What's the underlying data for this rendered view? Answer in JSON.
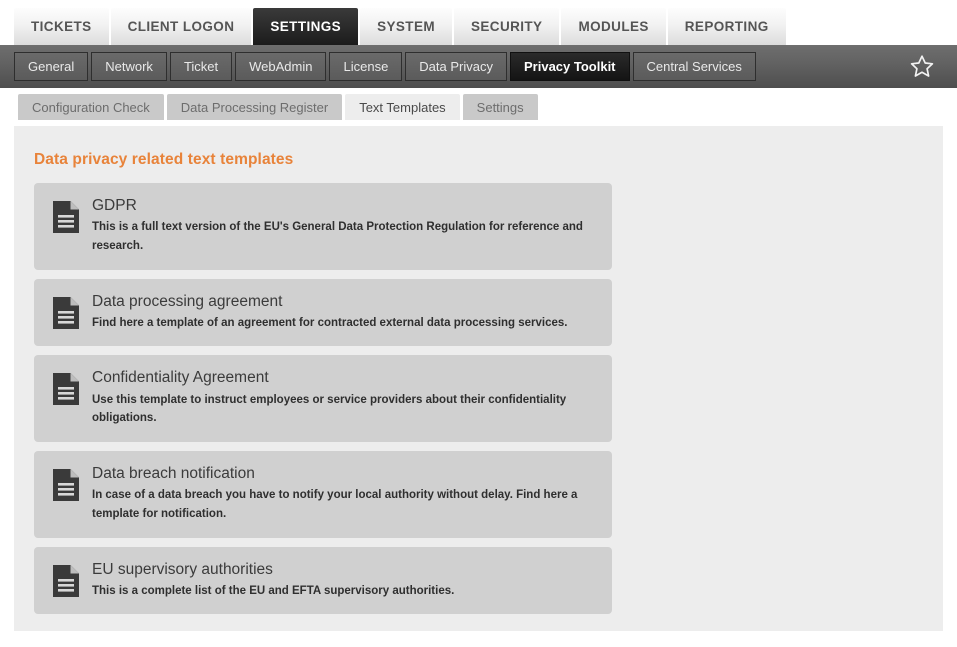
{
  "module_tabs": [
    {
      "label": "TICKETS",
      "active": false
    },
    {
      "label": "CLIENT LOGON",
      "active": false
    },
    {
      "label": "SETTINGS",
      "active": true
    },
    {
      "label": "SYSTEM",
      "active": false
    },
    {
      "label": "SECURITY",
      "active": false
    },
    {
      "label": "MODULES",
      "active": false
    },
    {
      "label": "REPORTING",
      "active": false
    }
  ],
  "subnav": {
    "items": [
      {
        "label": "General",
        "active": false
      },
      {
        "label": "Network",
        "active": false
      },
      {
        "label": "Ticket",
        "active": false
      },
      {
        "label": "WebAdmin",
        "active": false
      },
      {
        "label": "License",
        "active": false
      },
      {
        "label": "Data Privacy",
        "active": false
      },
      {
        "label": "Privacy Toolkit",
        "active": true
      },
      {
        "label": "Central Services",
        "active": false
      }
    ],
    "favorite_icon": "star-icon"
  },
  "content_tabs": [
    {
      "label": "Configuration Check",
      "active": false
    },
    {
      "label": "Data Processing Register",
      "active": false
    },
    {
      "label": "Text Templates",
      "active": true
    },
    {
      "label": "Settings",
      "active": false
    }
  ],
  "panel": {
    "title": "Data privacy related text templates",
    "title_color": "#e8833a",
    "background": "#ededed"
  },
  "templates": [
    {
      "icon": "document-icon",
      "title": "GDPR",
      "description": "This is a full text version of the EU's General Data Protection Regulation for reference and research."
    },
    {
      "icon": "document-icon",
      "title": "Data processing agreement",
      "description": "Find here a template of an agreement for contracted external data processing services."
    },
    {
      "icon": "document-icon",
      "title": "Confidentiality Agreement",
      "description": "Use this template to instruct employees or service providers about their confidentiality obligations."
    },
    {
      "icon": "document-icon",
      "title": "Data breach notification",
      "description": "In case of a data breach you have to notify your local authority without delay. Find here a template for notification."
    },
    {
      "icon": "document-icon",
      "title": "EU supervisory authorities",
      "description": "This is a complete list of the EU and EFTA supervisory authorities."
    }
  ],
  "colors": {
    "card_bg": "#d0d0d0",
    "accent": "#e8833a",
    "icon_dark": "#3a3a3a"
  }
}
